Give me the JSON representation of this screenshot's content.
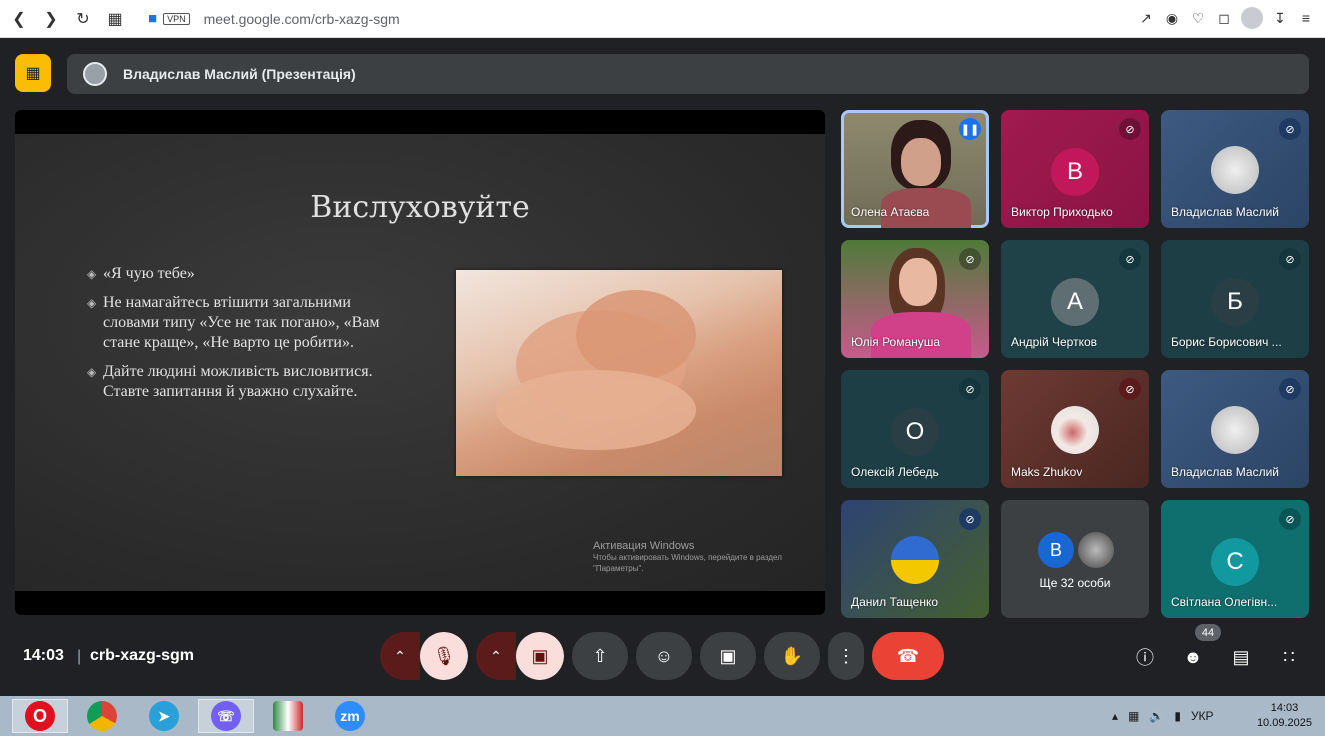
{
  "browser": {
    "url_host": "meet.google.com/",
    "url_path": "crb-xazg-sgm",
    "vpn_label": "VPN"
  },
  "banner": {
    "title": "Владислав Маслий (Презентація)"
  },
  "slide": {
    "title": "Вислуховуйте",
    "bullets": [
      "«Я чую тебе»",
      "Не намагайтесь втішити загальними словами типу «Усе не так погано», «Вам стане краще», «Не варто це робити».",
      "Дайте людині можливість висловитися. Ставте запитання й уважно слухайте."
    ],
    "watermark_title": "Активация Windows",
    "watermark_text": "Чтобы активировать Windows, перейдите в раздел \"Параметры\"."
  },
  "participants": [
    {
      "name": "Олена Атаєва",
      "type": "video",
      "mic": "speaking"
    },
    {
      "name": "Виктор Приходько",
      "type": "letter",
      "letter": "В",
      "mic": "muted"
    },
    {
      "name": "Владислав Маслий",
      "type": "photo",
      "mic": "muted"
    },
    {
      "name": "Юлія Романуша",
      "type": "video",
      "mic": "muted"
    },
    {
      "name": "Андрій Чертков",
      "type": "letter",
      "letter": "А",
      "mic": "muted"
    },
    {
      "name": "Борис Борисович ...",
      "type": "letter",
      "letter": "Б",
      "mic": "muted"
    },
    {
      "name": "Олексій Лебедь",
      "type": "letter",
      "letter": "О",
      "mic": "muted"
    },
    {
      "name": "Maks Zhukov",
      "type": "photo",
      "mic": "muted"
    },
    {
      "name": "Владислав Маслий",
      "type": "photo",
      "mic": "muted"
    },
    {
      "name": "Данил Тащенко",
      "type": "photo",
      "mic": "muted"
    },
    {
      "name": "Ще 32 особи",
      "type": "others",
      "letter": "В"
    },
    {
      "name": "Світлана Олегівн...",
      "type": "letter",
      "letter": "С",
      "mic": "muted"
    }
  ],
  "controls": {
    "time": "14:03",
    "separator": "|",
    "meeting_code": "crb-xazg-sgm",
    "participant_count": "44"
  },
  "taskbar": {
    "apps": [
      "opera-icon",
      "chrome-icon",
      "telegram-icon",
      "viber-icon",
      "winrar-icon",
      "zoom-icon"
    ],
    "zoom_label": "zm",
    "lang": "УКР",
    "clock_time": "14:03",
    "clock_date": "10.09.2025"
  },
  "colors": {
    "meet_bg": "#202124",
    "hangup": "#ea4335",
    "accent_yellow": "#fbbc04",
    "taskbar": "#a9b9c8"
  }
}
